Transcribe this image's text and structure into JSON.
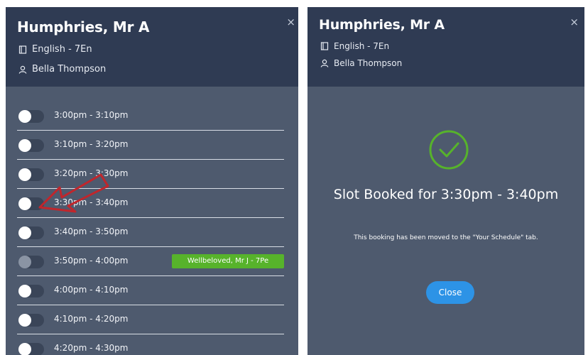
{
  "left_panel": {
    "title": "Humphries, Mr A",
    "subject": "English - 7En",
    "student": "Bella Thompson",
    "close_glyph": "×",
    "slots": [
      {
        "time": "3:00pm - 3:10pm",
        "enabled": true
      },
      {
        "time": "3:10pm - 3:20pm",
        "enabled": true
      },
      {
        "time": "3:20pm - 3:30pm",
        "enabled": true
      },
      {
        "time": "3:30pm - 3:40pm",
        "enabled": true
      },
      {
        "time": "3:40pm - 3:50pm",
        "enabled": true
      },
      {
        "time": "3:50pm - 4:00pm",
        "enabled": false,
        "booked_by": "Wellbeloved, Mr J - 7Pe"
      },
      {
        "time": "4:00pm - 4:10pm",
        "enabled": true
      },
      {
        "time": "4:10pm - 4:20pm",
        "enabled": true
      },
      {
        "time": "4:20pm - 4:30pm",
        "enabled": true
      }
    ]
  },
  "right_panel": {
    "title": "Humphries, Mr A",
    "subject": "English - 7En",
    "student": "Bella Thompson",
    "close_glyph": "×",
    "success_title": "Slot Booked for 3:30pm - 3:40pm",
    "success_message": "This booking has been moved to the \"Your Schedule\" tab.",
    "close_button_label": "Close"
  },
  "icons": {
    "subject": "book-icon",
    "student": "person-icon",
    "success": "check-circle-icon",
    "annotation": "red-arrow-icon"
  },
  "colors": {
    "header_bg": "#2f3b53",
    "panel_bg": "#4e5a6e",
    "success_green": "#57b32b",
    "button_blue": "#2d93e6",
    "annotation_red": "#c0262c"
  }
}
